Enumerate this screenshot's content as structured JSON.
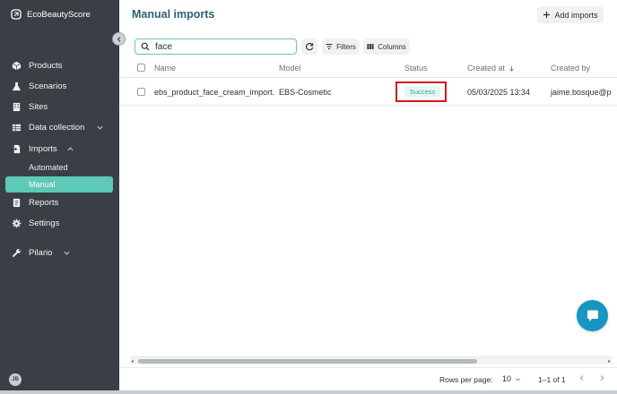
{
  "app": {
    "brand": "EcoBeautyScore"
  },
  "sidebar": {
    "items": [
      {
        "label": "Products",
        "icon": "cube-icon"
      },
      {
        "label": "Scenarios",
        "icon": "flask-icon"
      },
      {
        "label": "Sites",
        "icon": "building-icon"
      },
      {
        "label": "Data collection",
        "icon": "table-icon",
        "expanded": false
      },
      {
        "label": "Imports",
        "icon": "import-icon",
        "expanded": true
      },
      {
        "label": "Reports",
        "icon": "report-icon"
      },
      {
        "label": "Settings",
        "icon": "gear-icon"
      },
      {
        "label": "Pilario",
        "icon": "wrench-icon",
        "expanded": false
      }
    ],
    "imports_sub": [
      {
        "label": "Automated",
        "active": false
      },
      {
        "label": "Manual",
        "active": true
      }
    ],
    "avatar_initials": "JB",
    "accent_color": "#5dc9b6"
  },
  "header": {
    "title": "Manual imports",
    "add_button": "Add imports"
  },
  "toolbar": {
    "search_value": "face",
    "filters_label": "Filters",
    "columns_label": "Columns"
  },
  "table": {
    "columns": [
      "Name",
      "Model",
      "Status",
      "Created at",
      "Created by"
    ],
    "sort_column": "Created at",
    "sort_direction": "desc",
    "rows": [
      {
        "name": "ebs_product_face_cream_import...",
        "model": "EBS-Cosmetic",
        "status": "Success",
        "created_at": "05/03/2025 13:34",
        "created_by": "jaime.bosque@p"
      }
    ]
  },
  "pagination": {
    "rows_per_page_label": "Rows per page:",
    "rows_per_page": "10",
    "range": "1–1 of 1"
  },
  "colors": {
    "title": "#2f5f7a",
    "status_success": "#2fa890",
    "highlight": "#d8141d",
    "chat": "#1796c1"
  }
}
